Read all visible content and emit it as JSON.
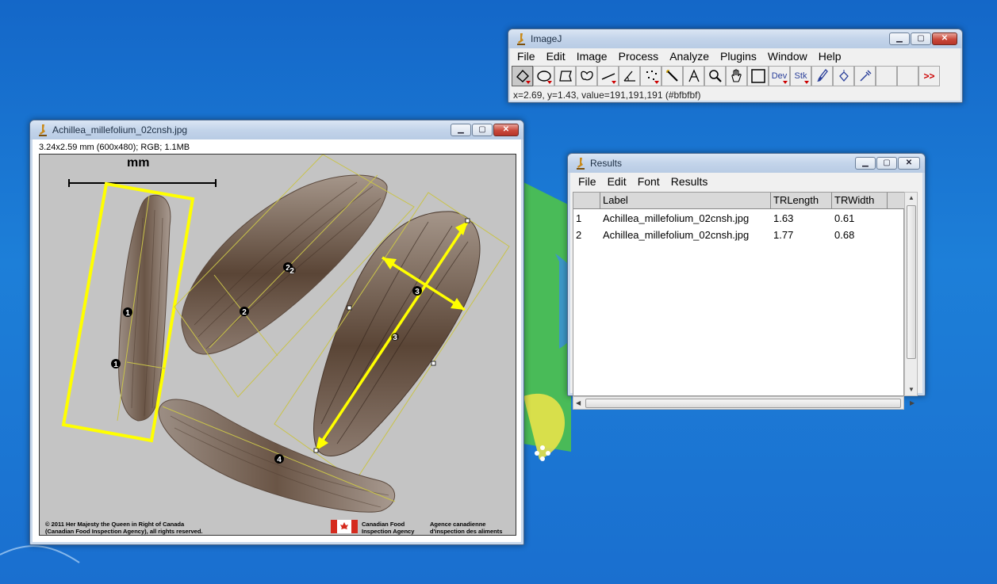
{
  "imagej_window": {
    "title": "ImageJ",
    "menu": [
      "File",
      "Edit",
      "Image",
      "Process",
      "Analyze",
      "Plugins",
      "Window",
      "Help"
    ],
    "tools": [
      {
        "name": "rotated-rectangle-tool-icon",
        "active": true
      },
      {
        "name": "oval-tool-icon"
      },
      {
        "name": "polygon-tool-icon"
      },
      {
        "name": "freehand-tool-icon"
      },
      {
        "name": "line-tool-icon"
      },
      {
        "name": "angle-tool-icon"
      },
      {
        "name": "multipoint-tool-icon"
      },
      {
        "name": "wand-tool-icon"
      },
      {
        "name": "text-tool-icon"
      },
      {
        "name": "magnifier-tool-icon"
      },
      {
        "name": "hand-tool-icon"
      },
      {
        "name": "color-picker-tool-icon"
      }
    ],
    "extra_tools": {
      "dev": "Dev",
      "stk": "Stk",
      "more": ">>"
    },
    "status": "x=2.69, y=1.43, value=191,191,191 (#bfbfbf)"
  },
  "image_window": {
    "title": "Achillea_millefolium_02cnsh.jpg",
    "info": "3.24x2.59 mm (600x480); RGB; 1.1MB",
    "scale_label": "mm",
    "roi_labels": [
      "1",
      "1",
      "2",
      "2",
      "2",
      "3",
      "3",
      "4"
    ],
    "credit_line1": "© 2011 Her Majesty the Queen in Right of Canada",
    "credit_line2": "(Canadian Food Inspection Agency), all rights reserved.",
    "agency_en_line1": "Canadian Food",
    "agency_en_line2": "Inspection Agency",
    "agency_fr_line1": "Agence canadienne",
    "agency_fr_line2": "d'inspection des aliments"
  },
  "results_window": {
    "title": "Results",
    "menu": [
      "File",
      "Edit",
      "Font",
      "Results"
    ],
    "columns": [
      "",
      "Label",
      "TRLength",
      "TRWidth"
    ],
    "rows": [
      {
        "index": "1",
        "label": "Achillea_millefolium_02cnsh.jpg",
        "length": "1.63",
        "width": "0.61"
      },
      {
        "index": "2",
        "label": "Achillea_millefolium_02cnsh.jpg",
        "length": "1.77",
        "width": "0.68"
      }
    ]
  },
  "colors": {
    "desktop": "#1a72d2",
    "roi_yellow": "#ffff00",
    "seed_brown": "#6e5a4c"
  }
}
